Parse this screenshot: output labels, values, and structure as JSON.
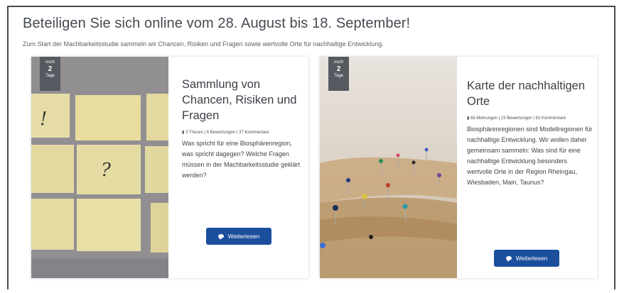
{
  "header": {
    "title": "Beteiligen Sie sich online vom 28. August bis 18. September!",
    "subtitle": "Zum Start der Machbarkeitsstudie sammeln wir Chancen, Risiken und Fragen sowie wertvolle Orte für nachhaltige Entwicklung."
  },
  "cards": [
    {
      "badge": {
        "prefix": "noch",
        "number": "2",
        "suffix": "Tage"
      },
      "image_marks": {
        "exclaim": "!",
        "question": "?"
      },
      "title": "Sammlung von Chancen, Risiken und Fragen",
      "meta": "3 Thesen | 6 Bewertungen | 37 Kommentare",
      "description": "Was spricht für eine Biosphärenregion, was spricht dagegen? Welche Fragen müssen in der Machbarkeitsstudie geklärt werden?",
      "button_label": "Weiterlesen"
    },
    {
      "badge": {
        "prefix": "noch",
        "number": "2",
        "suffix": "Tage"
      },
      "title": "Karte der nachhaltigen Orte",
      "meta": "66 Meinungen | 23 Bewertungen | 63 Kommentare",
      "description": "Biosphärenregionen sind Modellregionen für nachhaltige Entwicklung. Wir wollen daher gemeinsam sammeln: Was sind für eine nachhaltige Entwicklung besonders wertvolle Orte in der Region Rheingau, Wiesbaden, Main, Taunus?",
      "button_label": "Weiterlesen"
    }
  ],
  "colors": {
    "accent": "#1b4f9c",
    "badge": "#555960",
    "text": "#3b3f45"
  }
}
